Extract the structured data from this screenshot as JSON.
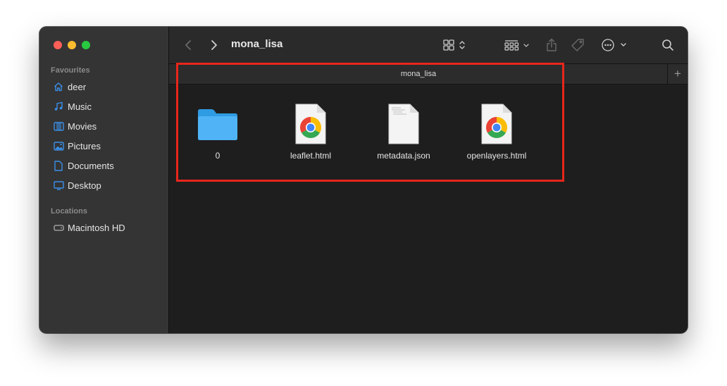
{
  "window": {
    "title": "mona_lisa"
  },
  "sidebar": {
    "favourites_title": "Favourites",
    "favourites": [
      {
        "label": "deer",
        "icon": "home-icon"
      },
      {
        "label": "Music",
        "icon": "music-icon"
      },
      {
        "label": "Movies",
        "icon": "film-icon"
      },
      {
        "label": "Pictures",
        "icon": "photo-icon"
      },
      {
        "label": "Documents",
        "icon": "document-icon"
      },
      {
        "label": "Desktop",
        "icon": "desktop-icon"
      }
    ],
    "locations_title": "Locations",
    "locations": [
      {
        "label": "Macintosh HD",
        "icon": "disk-icon"
      }
    ]
  },
  "tab": {
    "label": "mona_lisa",
    "plus": "+"
  },
  "files": [
    {
      "name": "0",
      "kind": "folder"
    },
    {
      "name": "leaflet.html",
      "kind": "chrome-html"
    },
    {
      "name": "metadata.json",
      "kind": "json"
    },
    {
      "name": "openlayers.html",
      "kind": "chrome-html"
    }
  ],
  "colors": {
    "accent": "#3b8fe8",
    "folder": "#4fb3f6",
    "highlight": "#e8261b"
  }
}
